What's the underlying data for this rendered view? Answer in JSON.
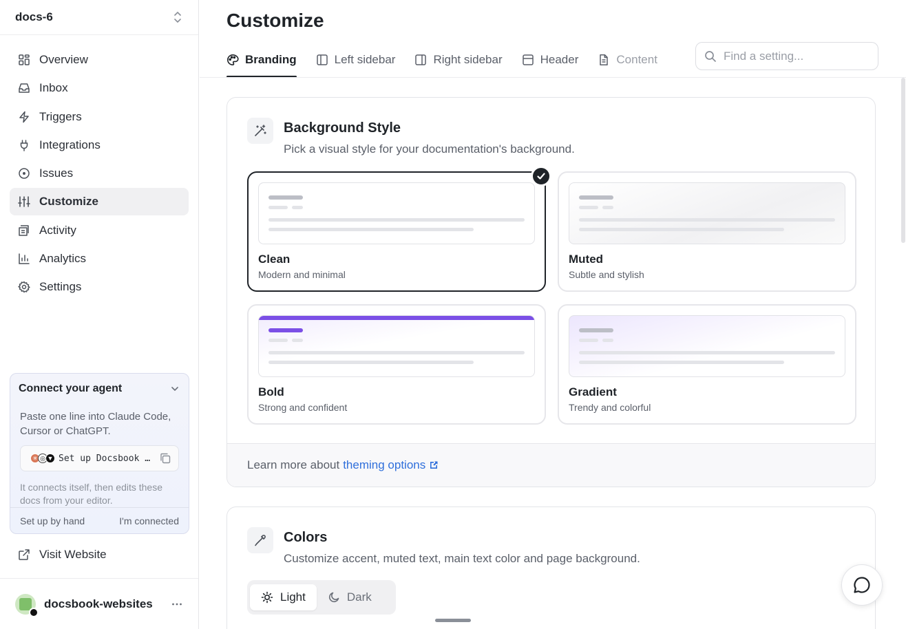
{
  "sidebar": {
    "project": "docs-6",
    "nav": [
      {
        "label": "Overview",
        "icon": "layout-grid-icon"
      },
      {
        "label": "Inbox",
        "icon": "inbox-icon"
      },
      {
        "label": "Triggers",
        "icon": "bolt-icon"
      },
      {
        "label": "Integrations",
        "icon": "plug-icon"
      },
      {
        "label": "Issues",
        "icon": "circle-dot-icon"
      },
      {
        "label": "Customize",
        "icon": "sliders-icon",
        "active": true
      },
      {
        "label": "Activity",
        "icon": "activity-icon"
      },
      {
        "label": "Analytics",
        "icon": "bar-chart-icon"
      },
      {
        "label": "Settings",
        "icon": "gear-icon"
      }
    ],
    "agent": {
      "title": "Connect your agent",
      "description": "Paste one line into Claude Code, Cursor or ChatGPT.",
      "command": "Set up Docsbook MCP",
      "note": "It connects itself, then edits these docs from your editor.",
      "setup_by_hand": "Set up by hand",
      "connected": "I'm connected"
    },
    "visit_website": "Visit Website",
    "account": "docsbook-websites"
  },
  "main": {
    "title": "Customize",
    "tabs": [
      {
        "label": "Branding",
        "icon": "palette-icon"
      },
      {
        "label": "Left sidebar",
        "icon": "panel-left-icon"
      },
      {
        "label": "Right sidebar",
        "icon": "panel-right-icon"
      },
      {
        "label": "Header",
        "icon": "panel-top-icon"
      },
      {
        "label": "Content",
        "icon": "file-text-icon"
      }
    ],
    "search_placeholder": "Find a setting...",
    "background": {
      "title": "Background Style",
      "subtitle": "Pick a visual style for your documentation's background.",
      "options": [
        {
          "label": "Clean",
          "description": "Modern and minimal",
          "selected": true
        },
        {
          "label": "Muted",
          "description": "Subtle and stylish"
        },
        {
          "label": "Bold",
          "description": "Strong and confident"
        },
        {
          "label": "Gradient",
          "description": "Trendy and colorful"
        }
      ],
      "footer_text": "Learn more about",
      "footer_link": "theming options"
    },
    "colors": {
      "title": "Colors",
      "subtitle": "Customize accent, muted text, main text color and page background.",
      "modes": [
        "Light",
        "Dark"
      ]
    }
  },
  "theme": {
    "accent": "#7b4fe6",
    "link": "#2f6fdb",
    "text": "#1f2328"
  }
}
